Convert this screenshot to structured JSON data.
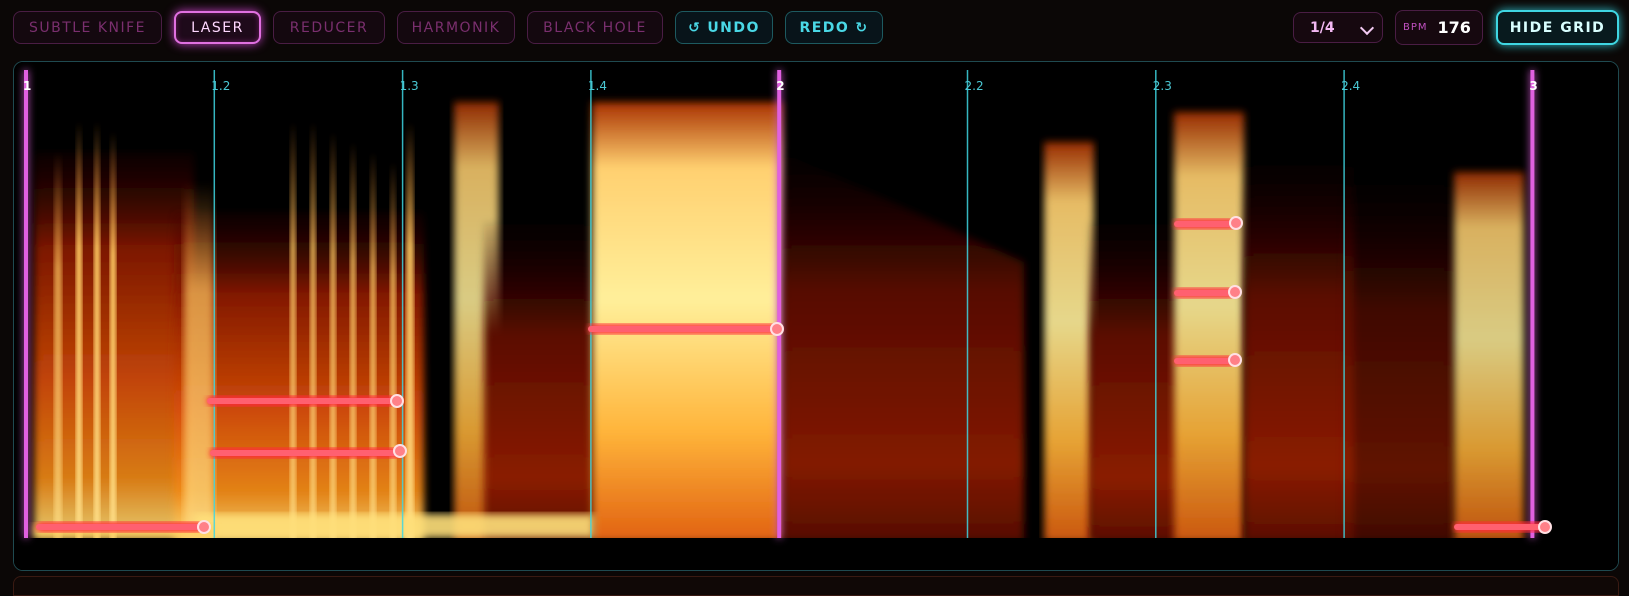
{
  "toolbar": {
    "tools": [
      {
        "label": "SUBTLE KNIFE",
        "active": false
      },
      {
        "label": "LASER",
        "active": true
      },
      {
        "label": "REDUCER",
        "active": false
      },
      {
        "label": "HARMONIK",
        "active": false
      },
      {
        "label": "BLACK HOLE",
        "active": false
      }
    ],
    "undo": {
      "label": "UNDO",
      "icon": "undo-icon"
    },
    "redo": {
      "label": "REDO",
      "icon": "redo-icon"
    },
    "grid_division": "1/4",
    "bpm_label": "BPM",
    "bpm_value": "176",
    "hide_grid_label": "HIDE GRID"
  },
  "grid": {
    "beats": [
      {
        "label": "1",
        "bar": true
      },
      {
        "label": "1.2",
        "bar": false
      },
      {
        "label": "1.3",
        "bar": false
      },
      {
        "label": "1.4",
        "bar": false
      },
      {
        "label": "2",
        "bar": true
      },
      {
        "label": "2.2",
        "bar": false
      },
      {
        "label": "2.3",
        "bar": false
      },
      {
        "label": "2.4",
        "bar": false
      },
      {
        "label": "3",
        "bar": true
      }
    ]
  },
  "colors": {
    "accent_magenta": "#e060e0",
    "accent_cyan": "#3fd6e2",
    "laser_red": "#ff3040",
    "background": "#0b0706"
  }
}
